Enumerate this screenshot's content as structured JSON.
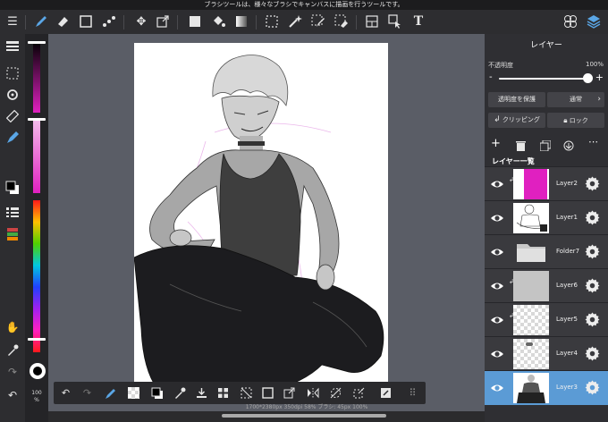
{
  "status_bar": {
    "tooltip": "ブラシツールは、様々なブラシでキャンバスに描画を行うツールです。"
  },
  "toolbar": {
    "tools": [
      {
        "icon": "menu-icon",
        "glyph": "☰"
      },
      {
        "icon": "brush-icon",
        "glyph": "✏"
      },
      {
        "icon": "eraser-icon",
        "glyph": "◆"
      },
      {
        "icon": "square-select-icon",
        "glyph": "□"
      },
      {
        "icon": "dot-tool-icon",
        "glyph": "⋰"
      },
      {
        "icon": "move-icon",
        "glyph": "✥"
      },
      {
        "icon": "transform-icon",
        "glyph": "⧉"
      },
      {
        "icon": "fill-color-icon",
        "glyph": "■"
      },
      {
        "icon": "bucket-icon",
        "glyph": "◓"
      },
      {
        "icon": "gradient-icon",
        "glyph": "▤"
      },
      {
        "icon": "lasso-select-icon",
        "glyph": "⬚"
      },
      {
        "icon": "magic-wand-icon",
        "glyph": "✦"
      },
      {
        "icon": "select-pen-icon",
        "glyph": "✎"
      },
      {
        "icon": "select-eraser-icon",
        "glyph": "✐"
      },
      {
        "icon": "frame-divider-icon",
        "glyph": "⊟"
      },
      {
        "icon": "operation-icon",
        "glyph": "⌖"
      },
      {
        "icon": "text-icon",
        "glyph": "T"
      },
      {
        "icon": "material-icon",
        "glyph": "❋"
      },
      {
        "icon": "layers-icon",
        "glyph": "◈"
      }
    ]
  },
  "colors": {
    "brush": "#000000",
    "accent": "#5b9bd5",
    "pink": "#e020c0"
  },
  "left_panel": {
    "zoom": "100",
    "zoom_unit": "%"
  },
  "layers_panel": {
    "title": "レイヤー",
    "opacity_label": "不透明度",
    "opacity_value": "100%",
    "opacity_fraction": 1.0,
    "minus": "-",
    "plus": "+",
    "protect_alpha": "透明度を保護",
    "blend_mode": "通常",
    "clipping": "クリッピング",
    "lock": "ロック",
    "list_label": "レイヤー一覧",
    "layers": [
      {
        "name": "Layer2",
        "clipped": true,
        "thumb": "pink"
      },
      {
        "name": "Layer1",
        "clipped": false,
        "thumb": "sketch"
      },
      {
        "name": "Folder7",
        "clipped": false,
        "thumb": "folder"
      },
      {
        "name": "Layer6",
        "clipped": true,
        "thumb": "gray"
      },
      {
        "name": "Layer5",
        "clipped": true,
        "thumb": "checker"
      },
      {
        "name": "Layer4",
        "clipped": false,
        "thumb": "checker"
      },
      {
        "name": "Layer3",
        "clipped": false,
        "thumb": "figure",
        "selected": true
      }
    ]
  },
  "info": "1700*2380px 350dpi 58% ブラシ: 45px 100%"
}
